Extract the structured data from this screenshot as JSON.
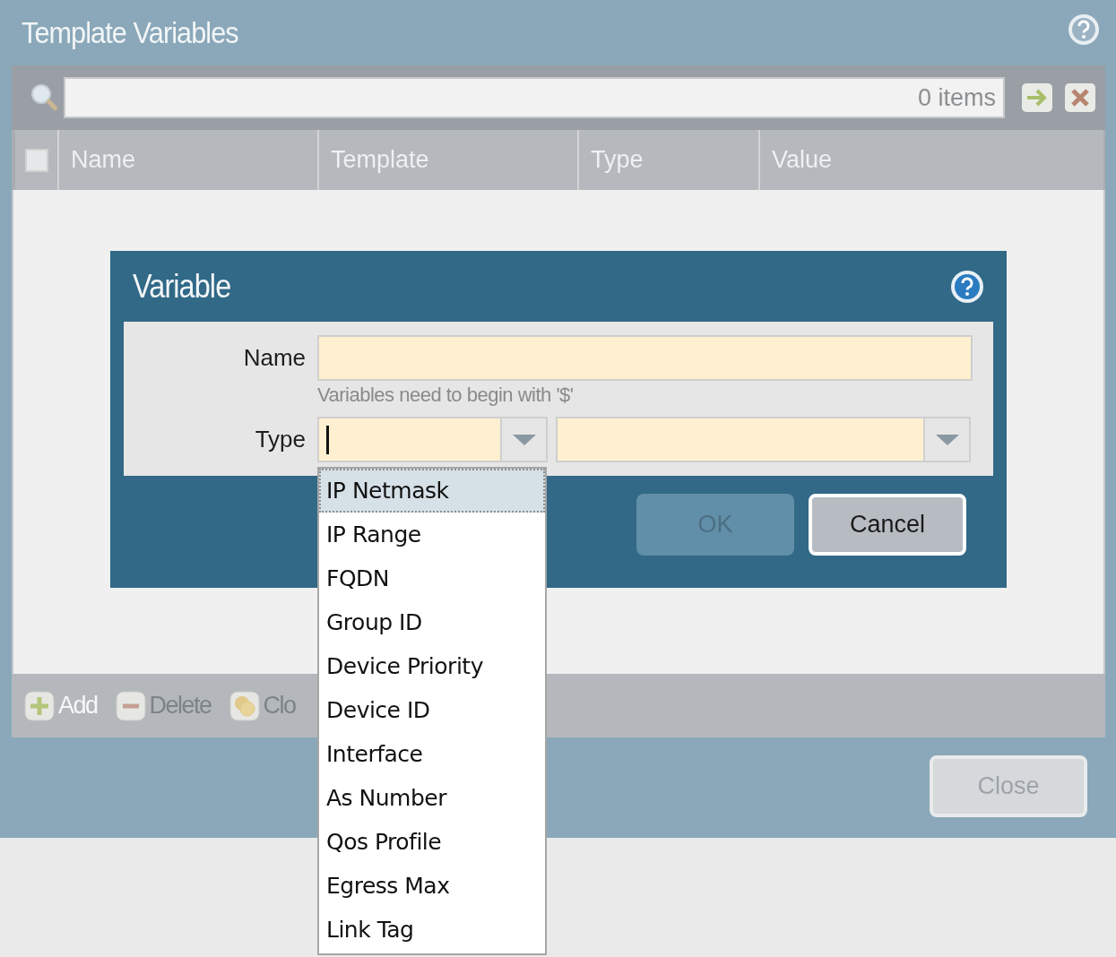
{
  "window": {
    "title": "Template Variables"
  },
  "search": {
    "placeholder": "0 items"
  },
  "table": {
    "select_all_checked": false,
    "columns": [
      "Name",
      "Template",
      "Type",
      "Value"
    ]
  },
  "toolbar": [
    {
      "label": "Add",
      "kind": "add",
      "disabled": false
    },
    {
      "label": "Delete",
      "kind": "delete",
      "disabled": true
    },
    {
      "label": "Clo",
      "kind": "clone",
      "disabled": true
    }
  ],
  "close_button": {
    "label": "Close"
  },
  "dialog": {
    "title": "Variable",
    "name_field": {
      "label": "Name",
      "hint": "Variables need to begin with '$'"
    },
    "type_field": {
      "label": "Type"
    },
    "buttons": [
      {
        "label": "OK",
        "disabled": true
      },
      {
        "label": "Cancel",
        "disabled": false
      }
    ],
    "type_options": [
      {
        "label": "IP Netmask",
        "selected": true
      },
      {
        "label": "IP Range",
        "selected": false
      },
      {
        "label": "FQDN",
        "selected": false
      },
      {
        "label": "Group ID",
        "selected": false
      },
      {
        "label": "Device Priority",
        "selected": false
      },
      {
        "label": "Device ID",
        "selected": false
      },
      {
        "label": "Interface",
        "selected": false
      },
      {
        "label": "As Number",
        "selected": false
      },
      {
        "label": "Qos Profile",
        "selected": false
      },
      {
        "label": "Egress Max",
        "selected": false
      },
      {
        "label": "Link Tag",
        "selected": false
      }
    ]
  }
}
